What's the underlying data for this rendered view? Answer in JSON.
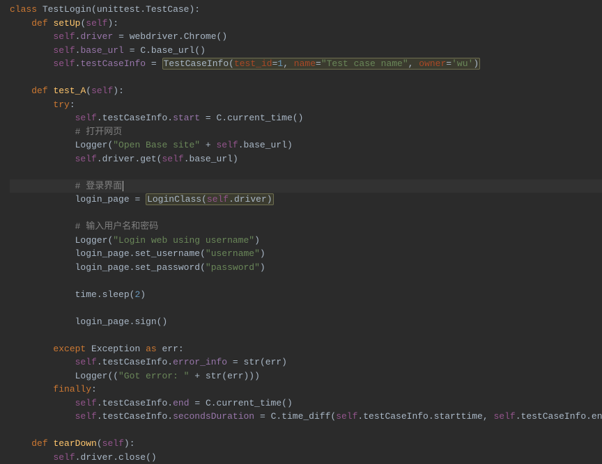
{
  "l1": {
    "kw_class": "class",
    "cls": "TestLogin",
    "base": "unittest.TestCase"
  },
  "l2": {
    "kw_def": "def",
    "name": "setUp",
    "self": "self"
  },
  "l3": {
    "self": "self",
    "attr": "driver",
    "rhs_call": "webdriver.Chrome"
  },
  "l4": {
    "self": "self",
    "attr": "base_url",
    "rhs_call": "C.base_url"
  },
  "l5": {
    "self": "self",
    "attr": "testCaseInfo",
    "call": "TestCaseInfo",
    "p1k": "test_id",
    "p1v": "1",
    "p2k": "name",
    "p2v": "\"Test case name\"",
    "p3k": "owner",
    "p3v": "'wu'"
  },
  "l6": {
    "kw_def": "def",
    "name": "test_A",
    "self": "self"
  },
  "l7": {
    "kw": "try"
  },
  "l8": {
    "self": "self",
    "attr1": "testCaseInfo",
    "attr2": "start",
    "rhs": "C.current_time()"
  },
  "l9": {
    "comment": "# 打开网页"
  },
  "l10": {
    "call": "Logger",
    "str": "\"Open Base site\"",
    "plus": " + ",
    "self": "self",
    "attr": "base_url"
  },
  "l11": {
    "self": "self",
    "chain": "driver.get",
    "self2": "self",
    "attr": "base_url"
  },
  "l12": {
    "comment": "# 登录界面"
  },
  "l13": {
    "lhs": "login_page",
    "call": "LoginClass",
    "self": "self",
    "attr": "driver"
  },
  "l14": {
    "comment": "# 输入用户名和密码"
  },
  "l15": {
    "call": "Logger",
    "str": "\"Login web using username\""
  },
  "l16": {
    "obj": "login_page",
    "method": "set_username",
    "str": "\"username\""
  },
  "l17": {
    "obj": "login_page",
    "method": "set_password",
    "str": "\"password\""
  },
  "l18": {
    "obj": "time",
    "method": "sleep",
    "arg": "2"
  },
  "l19": {
    "obj": "login_page",
    "method": "sign"
  },
  "l20": {
    "kw1": "except",
    "exc": "Exception",
    "kw2": "as",
    "var": "err"
  },
  "l21": {
    "self": "self",
    "attr1": "testCaseInfo",
    "attr2": "error_info",
    "call": "str",
    "arg": "err"
  },
  "l22": {
    "call": "Logger",
    "str": "\"Got error: \"",
    "plus": " + ",
    "call2": "str",
    "arg": "err"
  },
  "l23": {
    "kw": "finally"
  },
  "l24": {
    "self": "self",
    "attr1": "testCaseInfo",
    "attr2": "end",
    "rhs": "C.current_time()"
  },
  "l25": {
    "self": "self",
    "attr1": "testCaseInfo",
    "attr2": "secondsDuration",
    "call": "C.time_diff",
    "a1s": "self",
    "a1": "testCaseInfo.starttime",
    "a2s": "self",
    "a2": "testCaseInfo.endtime"
  },
  "l26": {
    "kw_def": "def",
    "name": "tearDown",
    "self": "self"
  },
  "l27": {
    "self": "self",
    "chain": "driver.close"
  }
}
